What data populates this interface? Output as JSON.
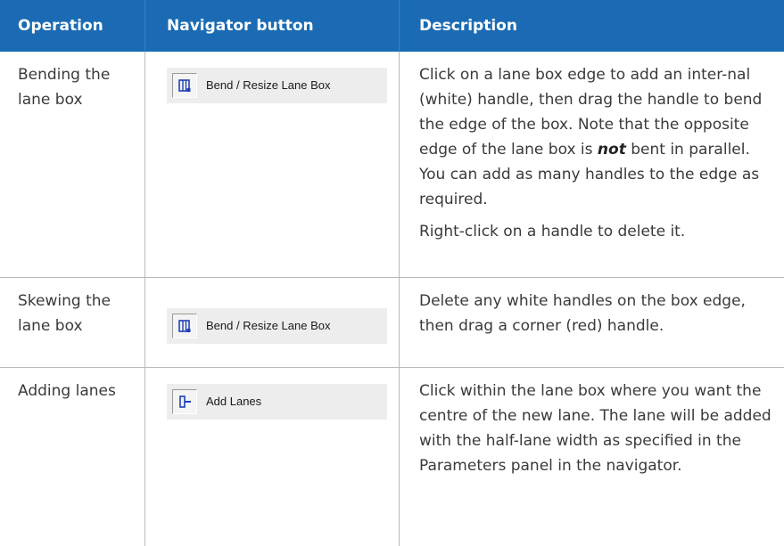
{
  "header": {
    "operation": "Operation",
    "navigator_button": "Navigator button",
    "description": "Description"
  },
  "rows": [
    {
      "operation": "Bending the lane box",
      "button_label": "Bend / Resize Lane Box",
      "button_icon": "bend-resize-lane-box-icon",
      "description": [
        "Click on a lane box edge to add an inter-nal (white) handle, then drag the handle to bend the edge of the box. Note that the opposite edge of the lane box is",
        "not",
        "bent in parallel. You can add as many handles to the edge as required.",
        "Right-click on a handle to delete it."
      ]
    },
    {
      "operation": "Skewing the lane box",
      "button_label": "Bend / Resize Lane Box",
      "button_icon": "bend-resize-lane-box-icon",
      "description": [
        "Delete any white handles on the box edge, then drag a corner (red) handle."
      ]
    },
    {
      "operation": "Adding lanes",
      "button_label": "Add Lanes",
      "button_icon": "add-lanes-icon",
      "description": [
        "Click within the lane box where you want the centre of the new lane. The lane will be added with the half-lane width as specified in the Parameters panel in the navigator."
      ]
    }
  ],
  "colors": {
    "header_bg": "#1a6bb3",
    "icon_blue": "#1f3fb5"
  }
}
